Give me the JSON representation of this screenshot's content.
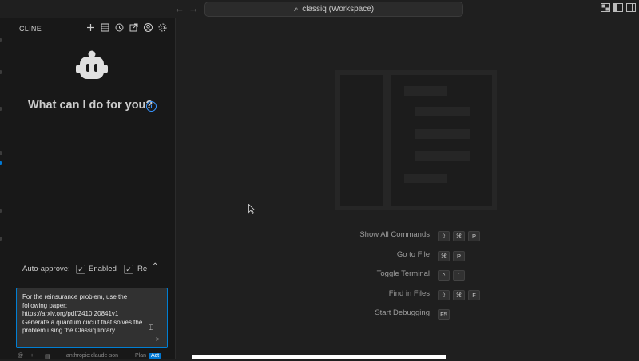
{
  "titlebar": {
    "back_icon": "arrow-left-icon",
    "forward_icon": "arrow-right-icon",
    "search_text": "classiq (Workspace)"
  },
  "sidebar": {
    "title": "CLINE",
    "toolbar_icons": [
      "plus-icon",
      "history-list-icon",
      "history-icon",
      "popout-icon",
      "account-icon",
      "gear-icon"
    ],
    "heading": "What can I do for you?",
    "auto_approve": {
      "label": "Auto-approve:",
      "items": [
        "Enabled",
        "Re"
      ]
    },
    "chat_input": {
      "value": "For the reinsurance problem, use the following paper:\nhttps://arxiv.org/pdf/2410.20841v1\nGenerate a quantum circuit that solves the problem using the Classiq library"
    },
    "bottom": {
      "at": "@",
      "plus": "+",
      "model": "anthropic:claude-son",
      "plan": "Plan",
      "act": "Act"
    }
  },
  "editor": {
    "shortcuts": [
      {
        "label": "Show All Commands",
        "keys": [
          "⇧",
          "⌘",
          "P"
        ]
      },
      {
        "label": "Go to File",
        "keys": [
          "⌘",
          "P"
        ]
      },
      {
        "label": "Toggle Terminal",
        "keys": [
          "^",
          "`"
        ]
      },
      {
        "label": "Find in Files",
        "keys": [
          "⇧",
          "⌘",
          "F"
        ]
      },
      {
        "label": "Start Debugging",
        "keys": [
          "F5"
        ]
      }
    ]
  },
  "colors": {
    "accent": "#0078d4",
    "focus_border": "#007fd4",
    "info": "#3794ff"
  }
}
